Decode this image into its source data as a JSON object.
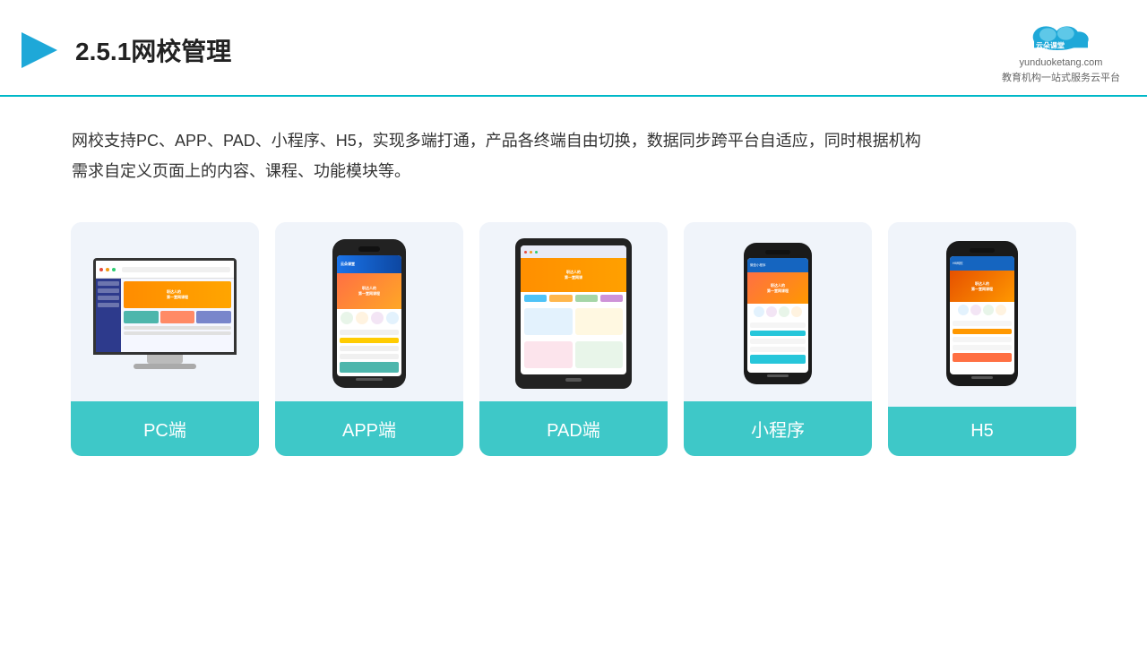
{
  "header": {
    "title": "2.5.1网校管理",
    "logo_name": "云朵课堂",
    "logo_url": "yunduoketang.com",
    "logo_tagline": "教育机构一站式服务云平台"
  },
  "description": {
    "text": "网校支持PC、APP、PAD、小程序、H5，实现多端打通，产品各终端自由切换，数据同步跨平台自适应，同时根据机构需求自定义页面上的内容、课程、功能模块等。"
  },
  "cards": [
    {
      "id": "pc",
      "label": "PC端"
    },
    {
      "id": "app",
      "label": "APP端"
    },
    {
      "id": "pad",
      "label": "PAD端"
    },
    {
      "id": "miniprogram",
      "label": "小程序"
    },
    {
      "id": "h5",
      "label": "H5"
    }
  ],
  "colors": {
    "accent": "#3ec8c8",
    "header_border": "#00b8c8",
    "bg_card": "#f0f4fa",
    "text_dark": "#222222",
    "text_body": "#333333"
  }
}
